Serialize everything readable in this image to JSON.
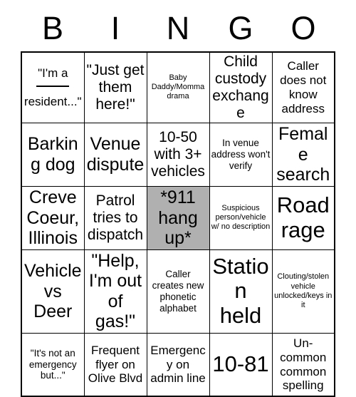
{
  "card": {
    "title": "BINGO",
    "header_letters": [
      "B",
      "I",
      "N",
      "G",
      "O"
    ],
    "marked_color": "#b0b0b0",
    "background_color": "#ffffff",
    "border_color": "#000000",
    "rows": 5,
    "columns": 5
  },
  "cells": [
    {
      "id": "b1",
      "column": "B",
      "row": 1,
      "text": "\"I'm a ____ resident...\"",
      "text_before_blank": "\"I'm a",
      "text_after_blank": "resident...\"",
      "has_blank": true,
      "marked": false,
      "size": "md"
    },
    {
      "id": "i1",
      "column": "I",
      "row": 1,
      "text": "\"Just get them here!\"",
      "marked": false,
      "size": "lg"
    },
    {
      "id": "n1",
      "column": "N",
      "row": 1,
      "text": "Baby Daddy/Momma drama",
      "marked": false,
      "size": "xs"
    },
    {
      "id": "g1",
      "column": "G",
      "row": 1,
      "text": "Child custody exchange",
      "marked": false,
      "size": "lg"
    },
    {
      "id": "o1",
      "column": "O",
      "row": 1,
      "text": "Caller does not know address",
      "marked": false,
      "size": "md"
    },
    {
      "id": "b2",
      "column": "B",
      "row": 2,
      "text": "Barking dog",
      "marked": false,
      "size": "xl"
    },
    {
      "id": "i2",
      "column": "I",
      "row": 2,
      "text": "Venue dispute",
      "marked": false,
      "size": "xl"
    },
    {
      "id": "n2",
      "column": "N",
      "row": 2,
      "text": "10-50 with 3+ vehicles",
      "marked": false,
      "size": "lg"
    },
    {
      "id": "g2",
      "column": "G",
      "row": 2,
      "text": "In venue address won't verify",
      "marked": false,
      "size": "sm"
    },
    {
      "id": "o2",
      "column": "O",
      "row": 2,
      "text": "Female search",
      "marked": false,
      "size": "xl"
    },
    {
      "id": "b3",
      "column": "B",
      "row": 3,
      "text": "Creve Coeur, Illinois",
      "marked": false,
      "size": "xl"
    },
    {
      "id": "i3",
      "column": "I",
      "row": 3,
      "text": "Patrol tries to dispatch",
      "marked": false,
      "size": "lg"
    },
    {
      "id": "n3",
      "column": "N",
      "row": 3,
      "text": "*911 hang up*",
      "marked": true,
      "size": "xl"
    },
    {
      "id": "g3",
      "column": "G",
      "row": 3,
      "text": "Suspicious person/vehicle w/ no description",
      "marked": false,
      "size": "xs"
    },
    {
      "id": "o3",
      "column": "O",
      "row": 3,
      "text": "Road rage",
      "marked": false,
      "size": "xxl"
    },
    {
      "id": "b4",
      "column": "B",
      "row": 4,
      "text": "Vehicle vs Deer",
      "marked": false,
      "size": "xl"
    },
    {
      "id": "i4",
      "column": "I",
      "row": 4,
      "text": "\"Help, I'm out of gas!\"",
      "marked": false,
      "size": "xl"
    },
    {
      "id": "n4",
      "column": "N",
      "row": 4,
      "text": "Caller creates new phonetic alphabet",
      "marked": false,
      "size": "sm"
    },
    {
      "id": "g4",
      "column": "G",
      "row": 4,
      "text": "Station held",
      "marked": false,
      "size": "xxl"
    },
    {
      "id": "o4",
      "column": "O",
      "row": 4,
      "text": "Clouting/stolen vehicle unlocked/keys in it",
      "marked": false,
      "size": "xs"
    },
    {
      "id": "b5",
      "column": "B",
      "row": 5,
      "text": "\"It's not an emergency but...\"",
      "marked": false,
      "size": "sm"
    },
    {
      "id": "i5",
      "column": "I",
      "row": 5,
      "text": "Frequent flyer on Olive Blvd",
      "marked": false,
      "size": "md"
    },
    {
      "id": "n5",
      "column": "N",
      "row": 5,
      "text": "Emergency on admin line",
      "marked": false,
      "size": "md"
    },
    {
      "id": "g5",
      "column": "G",
      "row": 5,
      "text": "10-81",
      "marked": false,
      "size": "xxl"
    },
    {
      "id": "o5",
      "column": "O",
      "row": 5,
      "text": "Un-common common spelling",
      "marked": false,
      "size": "md"
    }
  ]
}
